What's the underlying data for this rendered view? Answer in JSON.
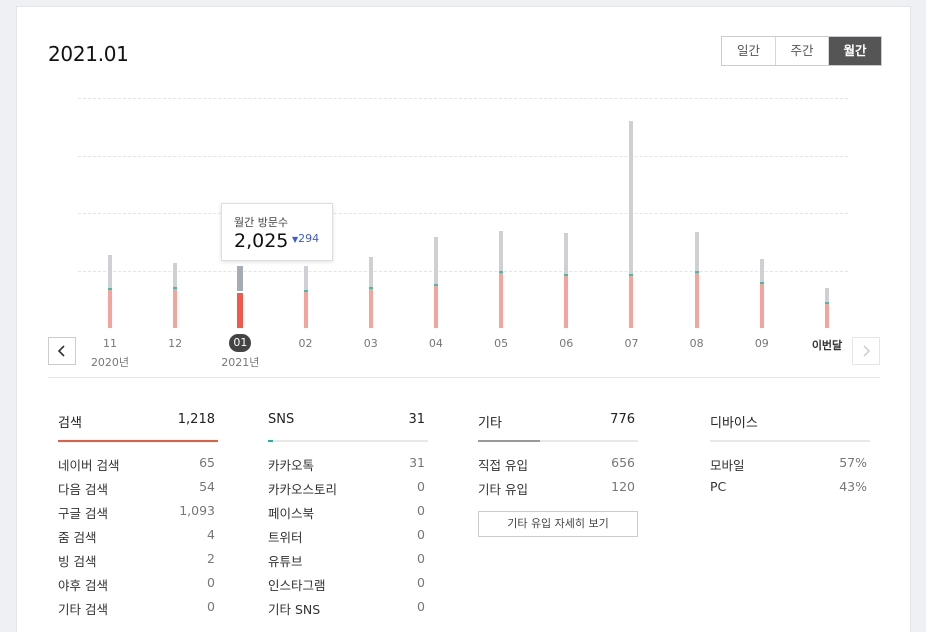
{
  "header": {
    "title": "2021.01"
  },
  "period_tabs": [
    {
      "label": "일간",
      "active": false
    },
    {
      "label": "주간",
      "active": false
    },
    {
      "label": "월간",
      "active": true
    }
  ],
  "chart_data": {
    "type": "bar",
    "categories": [
      "11",
      "12",
      "01",
      "02",
      "03",
      "04",
      "05",
      "06",
      "07",
      "08",
      "09",
      "이번달"
    ],
    "year_labels": {
      "11": "2020년",
      "01": "2021년"
    },
    "selected_index": 2,
    "series": [
      {
        "values": [
          1650,
          1660,
          1510,
          1550,
          1670,
          1810,
          2380,
          2240,
          2240,
          2350,
          1890,
          1030
        ]
      },
      {
        "values": [
          1420,
          1040,
          1080,
          1050,
          1300,
          2020,
          1700,
          1770,
          6570,
          1680,
          980,
          590
        ]
      }
    ],
    "colors": {
      "visitors": "#f4a49a",
      "visitors_selected": "#f4584a",
      "other": "#cdd0d5",
      "other_selected": "#a6acb4",
      "accent": "#3ec0a4"
    }
  },
  "tooltip": {
    "title": "월간 방문수",
    "value": "2,025",
    "change": "294"
  },
  "stats": {
    "search": {
      "title": "검색",
      "total": "1,218",
      "color": "#f05a3c",
      "fill": 1.0,
      "rows": [
        {
          "label": "네이버 검색",
          "value": "65"
        },
        {
          "label": "다음 검색",
          "value": "54"
        },
        {
          "label": "구글 검색",
          "value": "1,093"
        },
        {
          "label": "줌 검색",
          "value": "4"
        },
        {
          "label": "빙 검색",
          "value": "2"
        },
        {
          "label": "야후 검색",
          "value": "0"
        },
        {
          "label": "기타 검색",
          "value": "0"
        }
      ]
    },
    "sns": {
      "title": "SNS",
      "total": "31",
      "color": "#20b89c",
      "fill": 0.03,
      "rows": [
        {
          "label": "카카오톡",
          "value": "31"
        },
        {
          "label": "카카오스토리",
          "value": "0"
        },
        {
          "label": "페이스북",
          "value": "0"
        },
        {
          "label": "트위터",
          "value": "0"
        },
        {
          "label": "유튜브",
          "value": "0"
        },
        {
          "label": "인스타그램",
          "value": "0"
        },
        {
          "label": "기타 SNS",
          "value": "0"
        }
      ]
    },
    "etc": {
      "title": "기타",
      "total": "776",
      "color": "#999999",
      "fill": 0.39,
      "rows": [
        {
          "label": "직접 유입",
          "value": "656"
        },
        {
          "label": "기타 유입",
          "value": "120"
        }
      ],
      "button": "기타 유입 자세히 보기"
    },
    "device": {
      "title": "디바이스",
      "rows": [
        {
          "label": "모바일",
          "value": "57%"
        },
        {
          "label": "PC",
          "value": "43%"
        }
      ]
    }
  }
}
